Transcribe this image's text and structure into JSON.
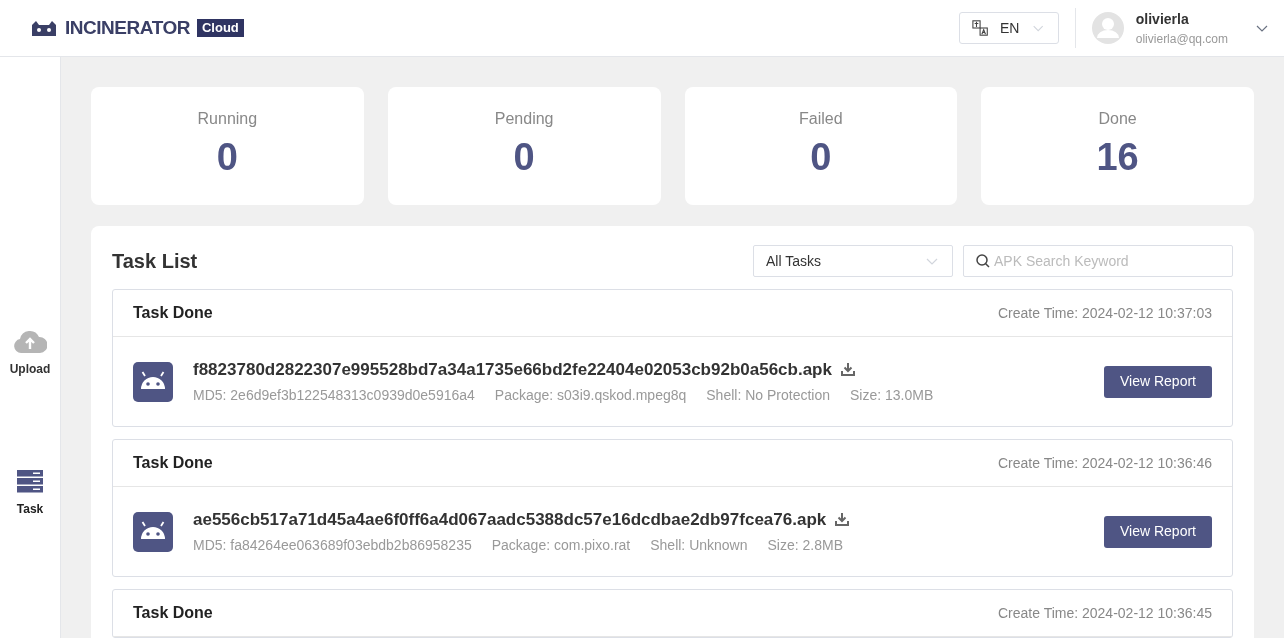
{
  "brand": {
    "name": "INCINERATOR",
    "badge": "Cloud"
  },
  "language": {
    "value": "EN"
  },
  "user": {
    "name": "olivierla",
    "email": "olivierla@qq.com"
  },
  "sidebar": {
    "items": [
      {
        "kind": "upload",
        "label": "Upload",
        "selected": false
      },
      {
        "kind": "task",
        "label": "Task",
        "selected": true
      }
    ]
  },
  "stats": [
    {
      "label": "Running",
      "value": "0"
    },
    {
      "label": "Pending",
      "value": "0"
    },
    {
      "label": "Failed",
      "value": "0"
    },
    {
      "label": "Done",
      "value": "16"
    }
  ],
  "task_list": {
    "title": "Task List",
    "filter": {
      "value": "All Tasks"
    },
    "search": {
      "placeholder": "APK Search Keyword"
    },
    "tasks": [
      {
        "status": "Task Done",
        "create_time": "Create Time: 2024-02-12 10:37:03",
        "file": "f8823780d2822307e995528bd7a34a1735e66bd2fe22404e02053cb92b0a56cb.apk",
        "md5": "MD5: 2e6d9ef3b122548313c0939d0e5916a4",
        "package": "Package: s03i9.qskod.mpeg8q",
        "shell": "Shell: No Protection",
        "size": "Size: 13.0MB",
        "button": "View Report"
      },
      {
        "status": "Task Done",
        "create_time": "Create Time: 2024-02-12 10:36:46",
        "file": "ae556cb517a71d45a4ae6f0ff6a4d067aadc5388dc57e16dcdbae2db97fcea76.apk",
        "md5": "MD5: fa84264ee063689f03ebdb2b86958235",
        "package": "Package: com.pixo.rat",
        "shell": "Shell: Unknown",
        "size": "Size: 2.8MB",
        "button": "View Report"
      },
      {
        "status": "Task Done",
        "create_time": "Create Time: 2024-02-12 10:36:45"
      }
    ]
  }
}
